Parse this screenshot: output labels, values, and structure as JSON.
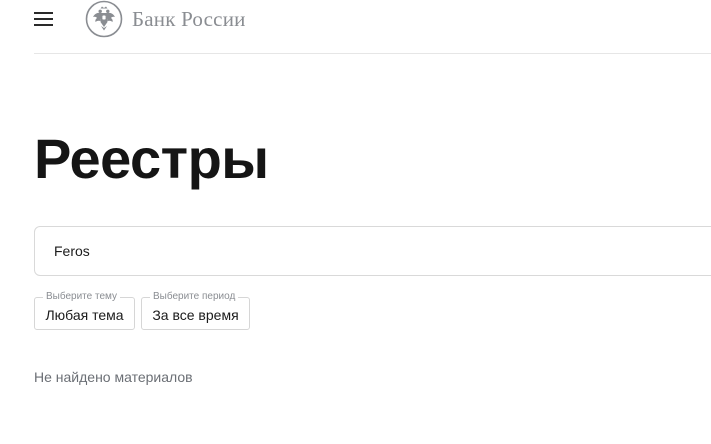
{
  "header": {
    "menu_icon": "hamburger-menu-icon",
    "logo_icon": "double-headed-eagle-emblem",
    "logo_text": "Банк России"
  },
  "page": {
    "title": "Реестры"
  },
  "search": {
    "value": "Feros"
  },
  "filters": {
    "topic": {
      "legend": "Выберите тему",
      "value": "Любая тема"
    },
    "period": {
      "legend": "Выберите период",
      "value": "За все время"
    }
  },
  "results": {
    "empty_message": "Не найдено материалов"
  },
  "colors": {
    "logo_text": "#8a8d92",
    "title": "#151515",
    "muted_text": "#6b6f75",
    "border": "#d9d9d9"
  }
}
